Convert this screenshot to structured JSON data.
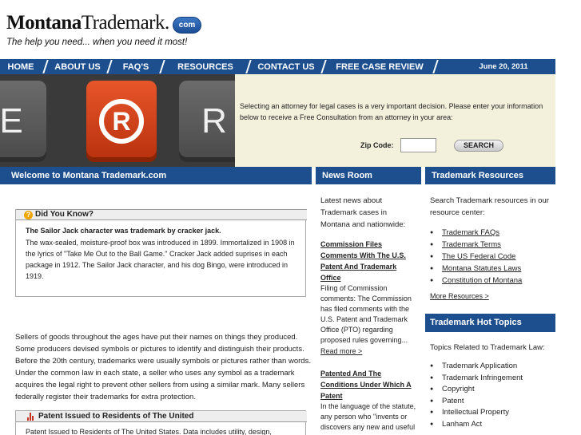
{
  "brand": {
    "name_bold": "Montana",
    "name_regular": "Trademark.",
    "pill": "com",
    "tagline": "The help you need... when you need it most!"
  },
  "nav": {
    "items": [
      "HOME",
      "ABOUT US",
      "FAQ'S",
      "RESOURCES",
      "CONTACT US",
      "FREE CASE REVIEW"
    ],
    "date": "June 20, 2011"
  },
  "hero": {
    "keys": [
      "E",
      "®",
      "R"
    ],
    "intro": "Selecting an attorney for legal cases is a very important decision. Please enter your information below to receive a Free Consultation from an attorney in your area:",
    "zip_label": "Zip Code:",
    "zip_value": "",
    "search_label": "SEARCH"
  },
  "sections": {
    "welcome": "Welcome to Montana Trademark.com",
    "news_room": "News Room",
    "resources": "Trademark Resources"
  },
  "did_you_know": {
    "header": "Did You Know?",
    "title": "The Sailor Jack character was trademark by cracker jack.",
    "body": "The wax-sealed, moisture-proof box was introduced in 1899. Immortalized in 1908 in the lyrics of \"Take Me Out to the Ball Game.\" Cracker Jack added suprises in each package in 1912. The Sailor Jack character, and his dog Bingo, were introduced in 1919."
  },
  "intro_text": "Sellers of goods throughout the ages have put their names on things they produced. Some producers devised symbols or pictures to identify and distinguish their products. Before the 20th century, trademarks were usually symbols or pictures rather than words. Under the common law in each state, a seller who uses any symbol as a trademark acquires the legal right to prevent other sellers from using a similar mark. Many sellers federally register their trademarks for extra protection.",
  "patent": {
    "header": "Patent Issued to Residents of The United",
    "body": "Patent Issued to Residents of The United States. Data includes utility, design,"
  },
  "news": {
    "intro": "Latest news about Trademark cases in Montana and nationwide:",
    "items": [
      {
        "headline": "Commission Files Comments With The U.S. Patent And Trademark Office",
        "body": "Filing of Commission comments: The Commission has filed comments with the U.S. Patent and Trademark Office (PTO) regarding proposed rules governing...",
        "more": "Read more >"
      },
      {
        "headline": "Patented And The Conditions Under Which A Patent",
        "body": "In the language of the statute, any person who \"invents or discovers any new and useful process,"
      }
    ]
  },
  "resources": {
    "intro": "Search Trademark resources in our resource center:",
    "links": [
      "Trademark FAQs",
      "Trademark Terms",
      "The US Federal Code",
      "Montana Statutes Laws",
      "Constitution of Montana"
    ],
    "more": "More Resources >"
  },
  "hot_topics": {
    "header": "Trademark Hot Topics",
    "intro": "Topics Related to Trademark Law:",
    "items": [
      "Trademark Application",
      "Trademark Infringement",
      "Copyright",
      "Patent",
      "Intellectual Property",
      "Lanham Act"
    ]
  }
}
